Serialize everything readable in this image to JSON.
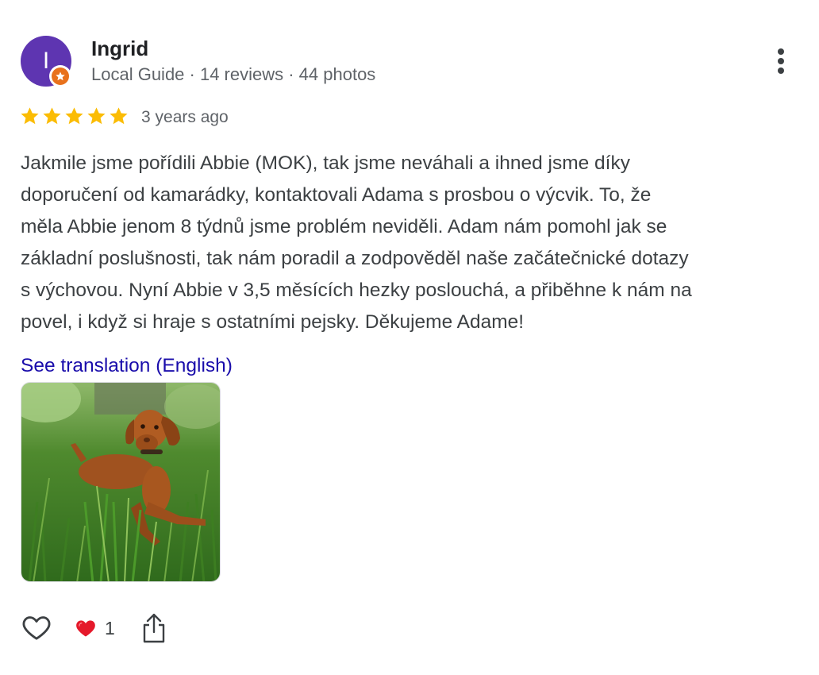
{
  "reviewer": {
    "name": "Ingrid",
    "initial": "I",
    "meta": "Local Guide · 14 reviews · 44 photos",
    "avatar_color": "#5e35b1",
    "badge_color": "#e8711c"
  },
  "rating": {
    "stars": 5,
    "max": 5,
    "star_color": "#fbbc04",
    "date": "3 years ago"
  },
  "review": {
    "lines": [
      "Jakmile jsme pořídili Abbie (MOK), tak jsme neváhali a ihned jsme díky",
      "doporučení od kamarádky, kontaktovali Adama s prosbou o výcvik. To, že",
      "měla Abbie jenom 8 týdnů jsme problém neviděli. Adam nám pomohl jak se",
      "základní poslušnosti, tak nám poradil a zodpověděl naše začátečnické dotazy",
      "s výchovou. Nyní Abbie v 3,5 měsících hezky poslouchá, a přiběhne k nám na",
      "povel, i když si hraje s ostatními pejsky. Děkujeme Adame!"
    ],
    "translation_link": "See translation (English)"
  },
  "photo": {
    "subject": "puppy lying in grass"
  },
  "actions": {
    "like_icon": "heart-outline-icon",
    "reaction_icon": "red-heart-icon",
    "reaction_count": "1",
    "share_icon": "share-icon"
  },
  "menu": {
    "icon": "more-vert-icon"
  }
}
